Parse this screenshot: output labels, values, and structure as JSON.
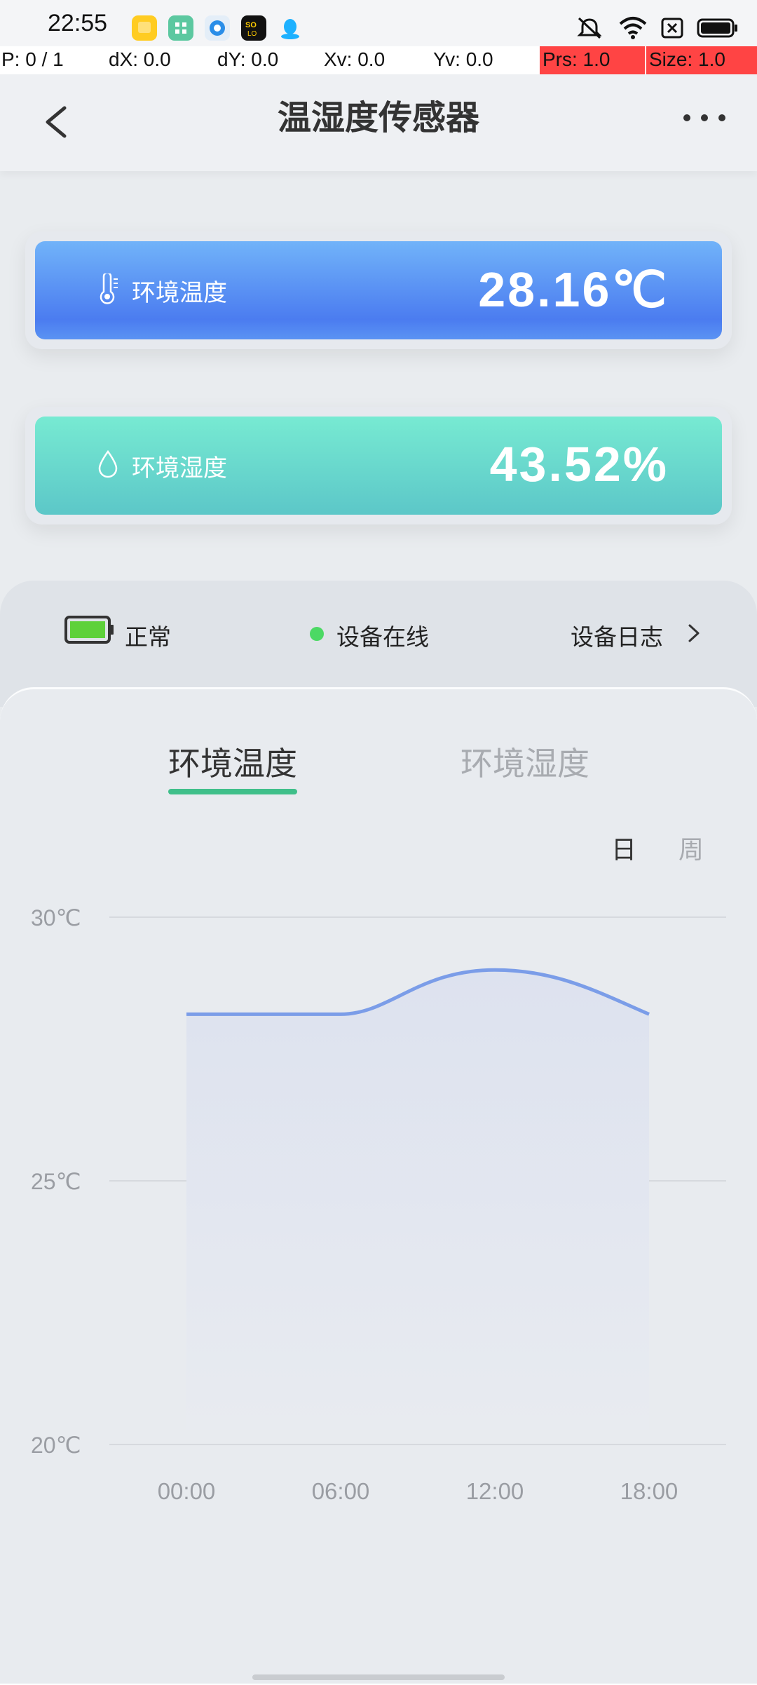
{
  "status_bar": {
    "time": "22:55",
    "app_icons": [
      "notes-app-icon",
      "grid-app-icon",
      "browser-app-icon",
      "solo-app-icon",
      "qq-app-icon"
    ],
    "right_icons": [
      "mute-bell-icon",
      "wifi-icon",
      "no-sim-icon",
      "battery-icon"
    ]
  },
  "pointer_overlay": {
    "p": "P: 0 / 1",
    "dx": "dX: 0.0",
    "dy": "dY: 0.0",
    "xv": "Xv: 0.0",
    "yv": "Yv: 0.0",
    "prs": "Prs: 1.0",
    "size": "Size: 1.0"
  },
  "header": {
    "title": "温湿度传感器"
  },
  "cards": {
    "temperature": {
      "label": "环境温度",
      "value": "28.16℃",
      "icon": "thermometer-icon"
    },
    "humidity": {
      "label": "环境湿度",
      "value": "43.52%",
      "icon": "water-drop-icon"
    }
  },
  "status": {
    "battery_text": "正常",
    "online_text": "设备在线",
    "log_text": "设备日志"
  },
  "tabs": [
    {
      "label": "环境温度",
      "active": true
    },
    {
      "label": "环境湿度",
      "active": false
    }
  ],
  "range": {
    "day": "日",
    "week": "周",
    "selected": "日"
  },
  "colors": {
    "accent_green": "#3fbf8a",
    "line_blue": "#7b9de8",
    "online_green": "#4cd964"
  },
  "chart_data": {
    "type": "area",
    "x": [
      "00:00",
      "06:00",
      "12:00",
      "18:00"
    ],
    "y_ticks": [
      "30℃",
      "25℃",
      "20℃"
    ],
    "ylim": [
      20,
      30
    ],
    "grid": true,
    "series": [
      {
        "values": [
          28.16,
          28.16,
          29.0,
          28.16
        ]
      }
    ]
  }
}
